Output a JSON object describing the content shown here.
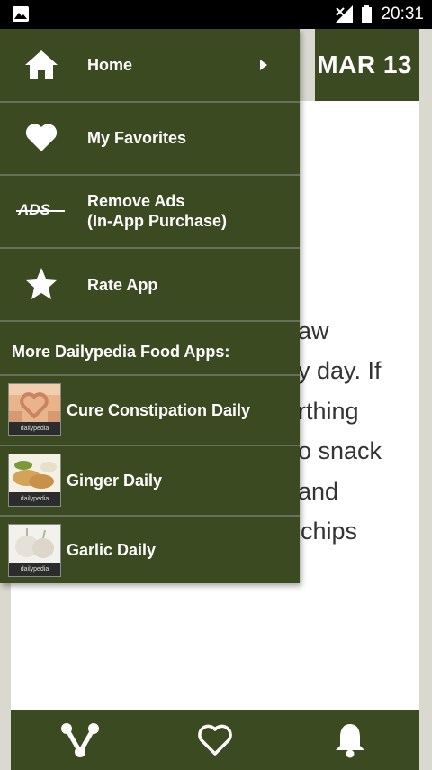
{
  "status_bar": {
    "time": "20:31"
  },
  "header": {
    "date": "MAR 13"
  },
  "article": {
    "lines": [
      "aw",
      "y day. If",
      "rthing",
      "o snack",
      "and",
      " chips"
    ]
  },
  "drawer": {
    "items": [
      {
        "label": "Home",
        "icon": "home-icon"
      },
      {
        "label": "My Favorites",
        "icon": "heart-icon"
      },
      {
        "label_line1": "Remove Ads",
        "label_line2": "(In-App Purchase)",
        "icon": "ads-icon",
        "icon_text": "ADS"
      },
      {
        "label": "Rate App",
        "icon": "star-icon"
      }
    ],
    "more_title": "More Dailypedia Food Apps:",
    "apps": [
      {
        "label": "Cure Constipation Daily",
        "brand": "dailypedia"
      },
      {
        "label": "Ginger Daily",
        "brand": "dailypedia"
      },
      {
        "label": "Garlic Daily",
        "brand": "dailypedia"
      }
    ]
  },
  "bottom_nav": {
    "icons": [
      "share-icon",
      "heart-outline-icon",
      "bell-icon"
    ]
  },
  "colors": {
    "primary": "#3c4a22",
    "divider": "#66705a",
    "background": "#d9d9cf"
  }
}
